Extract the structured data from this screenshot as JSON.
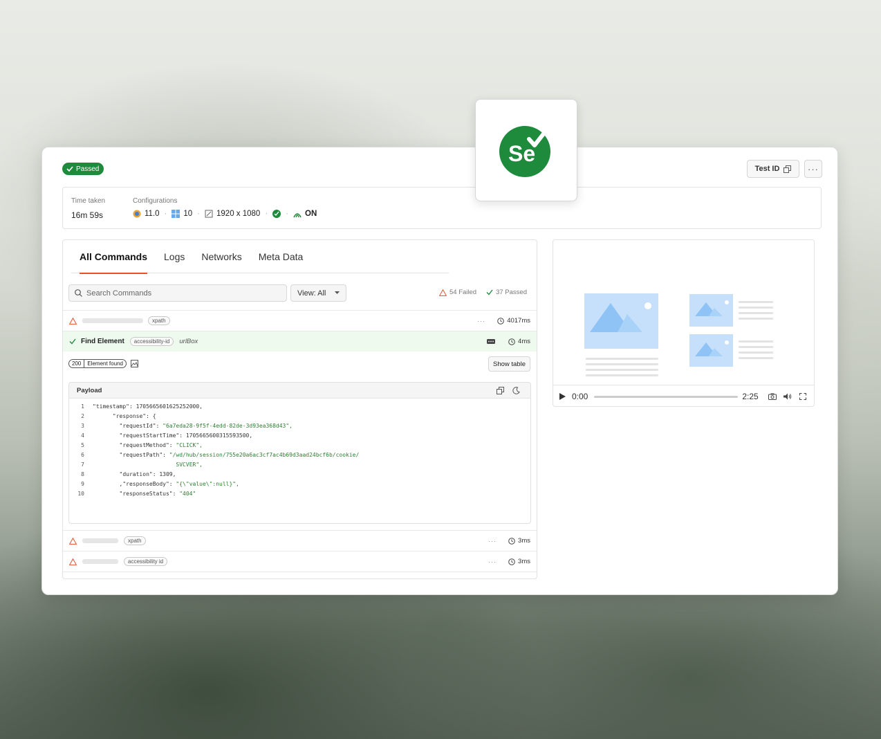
{
  "header": {
    "status_badge": "Passed",
    "test_id_label": "Test ID",
    "more_label": "···"
  },
  "info": {
    "time_taken_label": "Time taken",
    "time_taken_value": "16m 59s",
    "configurations_label": "Configurations",
    "browser_version": "11.0",
    "os_version": "10",
    "resolution": "1920 x 1080",
    "tunnel_state": "ON"
  },
  "tabs": [
    {
      "label": "All Commands",
      "active": true
    },
    {
      "label": "Logs",
      "active": false
    },
    {
      "label": "Networks",
      "active": false
    },
    {
      "label": "Meta Data",
      "active": false
    }
  ],
  "filters": {
    "search_placeholder": "Search Commands",
    "view_label": "View: All",
    "failed_count": "54 Failed",
    "passed_count": "37 Passed"
  },
  "commands": [
    {
      "status": "warning",
      "tag": "xpath",
      "duration": "4017ms"
    },
    {
      "status": "passed",
      "name": "Find Element",
      "tag": "accessibility-id",
      "arg": "urlBox",
      "duration": "4ms"
    },
    {
      "status": "warning",
      "tag": "xpath",
      "duration": "3ms"
    },
    {
      "status": "warning",
      "tag": "accessibility id",
      "duration": "3ms"
    }
  ],
  "response": {
    "code": "200",
    "message": "Element found",
    "show_table_label": "Show table"
  },
  "payload": {
    "title": "Payload",
    "lines": [
      {
        "n": "1",
        "indent": "",
        "key": "\"timestamp\": ",
        "val": "1705665601625252000,",
        "str": false
      },
      {
        "n": "2",
        "indent": "      ",
        "key": "\"response\": {",
        "val": "",
        "str": false
      },
      {
        "n": "3",
        "indent": "        ",
        "key": "\"requestId\": ",
        "val": "\"6a7eda28-9f5f-4edd-82de-3d93ea368d43\",",
        "str": true
      },
      {
        "n": "4",
        "indent": "        ",
        "key": "\"requestStartTime\": ",
        "val": "1705665600315593500,",
        "str": false
      },
      {
        "n": "5",
        "indent": "        ",
        "key": "\"requestMethod\": ",
        "val": "\"CLICK\",",
        "str": true
      },
      {
        "n": "6",
        "indent": "        ",
        "key": "\"requestPath\": ",
        "val": "\"/wd/hub/session/755e20a6ac3cf7ac4b69d3aad24bcf6b/cookie/",
        "str": true
      },
      {
        "n": "7",
        "indent": "                         ",
        "key": "",
        "val": "SVCVER\",",
        "str": true
      },
      {
        "n": "8",
        "indent": "        ",
        "key": "\"duration\": ",
        "val": "1309,",
        "str": false
      },
      {
        "n": "9",
        "indent": "        ",
        "key": ",\"responseBody\": ",
        "val": "\"{\\\"value\\\":null}\",",
        "str": true
      },
      {
        "n": "10",
        "indent": "        ",
        "key": "\"responseStatus\": ",
        "val": "\"404\"",
        "str": true
      }
    ]
  },
  "video": {
    "current_time": "0:00",
    "total_time": "2:25",
    "progress": 0
  },
  "logo": {
    "text": "Se",
    "color": "#1e8a3c"
  },
  "colors": {
    "passed": "#1e8a3c",
    "failed": "#e2532a",
    "accent": "#e2532a"
  }
}
